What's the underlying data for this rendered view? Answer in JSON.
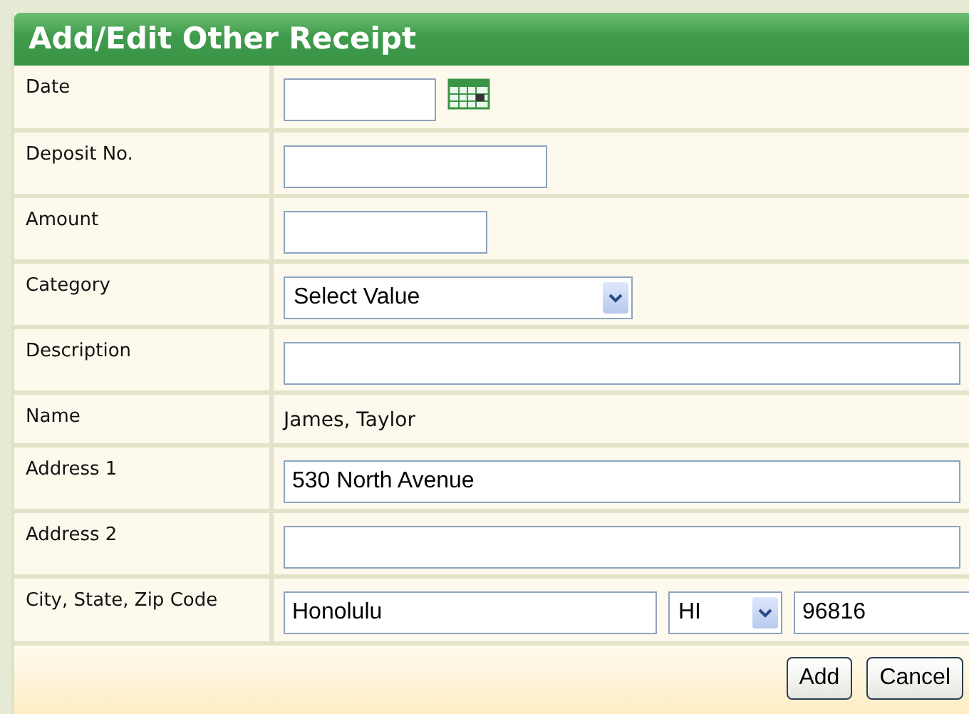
{
  "title": "Add/Edit Other Receipt",
  "rows": [
    {
      "label": "Date",
      "kind": "date",
      "value": ""
    },
    {
      "label": "Deposit No.",
      "kind": "medium",
      "value": ""
    },
    {
      "label": "Amount",
      "kind": "short",
      "value": ""
    },
    {
      "label": "Category",
      "kind": "select",
      "value": "Select Value"
    },
    {
      "label": "Description",
      "kind": "wide",
      "value": ""
    },
    {
      "label": "Name",
      "kind": "static",
      "value": "James, Taylor"
    },
    {
      "label": "Address 1",
      "kind": "wide",
      "value": "530 North Avenue"
    },
    {
      "label": "Address 2",
      "kind": "wide",
      "value": ""
    },
    {
      "label": "City, State, Zip Code",
      "kind": "citystatezip",
      "city": "Honolulu",
      "state": "HI",
      "zip": "96816"
    }
  ],
  "buttons": [
    "Add",
    "Cancel"
  ]
}
